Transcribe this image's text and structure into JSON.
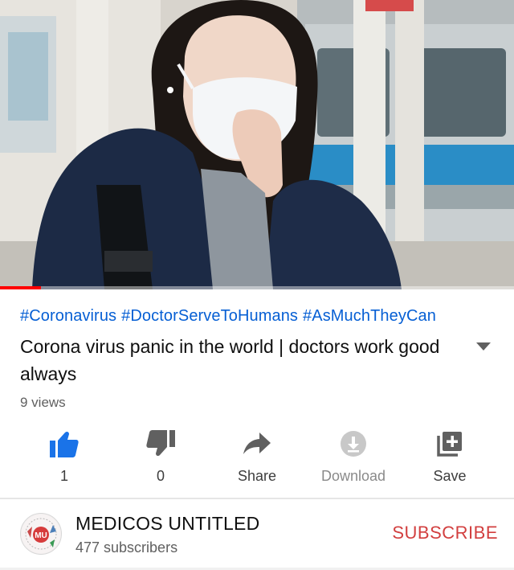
{
  "video": {
    "progress": 0.08,
    "accent_color": "#ff0000"
  },
  "hashtags": [
    "#Coronavirus",
    "#DoctorServeToHumans",
    "#AsMuchTheyCan"
  ],
  "title": "Corona virus panic in the world | doctors work good always",
  "views": "9 views",
  "actions": {
    "like": {
      "count": "1",
      "icon": "thumbs-up-icon",
      "color": "#065fd4"
    },
    "dislike": {
      "count": "0",
      "icon": "thumbs-down-icon"
    },
    "share": {
      "label": "Share",
      "icon": "share-arrow-icon"
    },
    "download": {
      "label": "Download",
      "icon": "download-icon"
    },
    "save": {
      "label": "Save",
      "icon": "playlist-add-icon"
    }
  },
  "channel": {
    "name": "MEDICOS UNTITLED",
    "subscribers": "477 subscribers",
    "avatar_text": "MU"
  },
  "subscribe_label": "SUBSCRIBE"
}
